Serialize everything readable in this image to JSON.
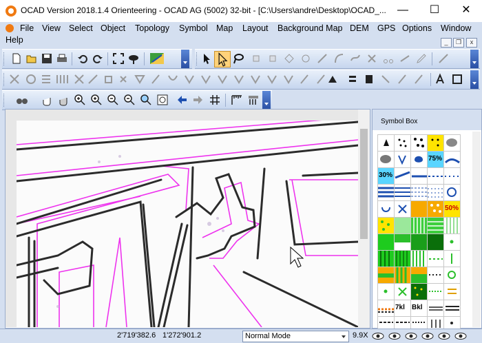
{
  "window": {
    "title": "OCAD Version 2018.1.4  Orienteering - OCAD AG (5002) 32-bit - [C:\\Users\\andre\\Desktop\\OCAD_...",
    "minimize": "—",
    "maximize": "☐",
    "close": "✕"
  },
  "menu": [
    "File",
    "View",
    "Select",
    "Object",
    "Topology",
    "Symbol",
    "Map",
    "Layout",
    "Background Map",
    "DEM",
    "GPS",
    "Options",
    "Window",
    "Help"
  ],
  "mdi": {
    "minimize": "_",
    "restore": "❐",
    "close": "x"
  },
  "symbol_box": {
    "title": "Symbol Box",
    "texts": [
      "75%",
      "30%",
      "50%",
      "7kl",
      "Bkl"
    ]
  },
  "status": {
    "x": "2'719'382.6",
    "y": "1'272'901.2",
    "mode": "Normal Mode",
    "zoom": "9.9X"
  },
  "colors": {
    "map_line": "#2b2b2b",
    "map_magenta": "#ee33ee",
    "accent_blue": "#2a4fa3",
    "yellow": "#ffe400",
    "green": "#2bbf2b",
    "orange": "#f7a900"
  }
}
